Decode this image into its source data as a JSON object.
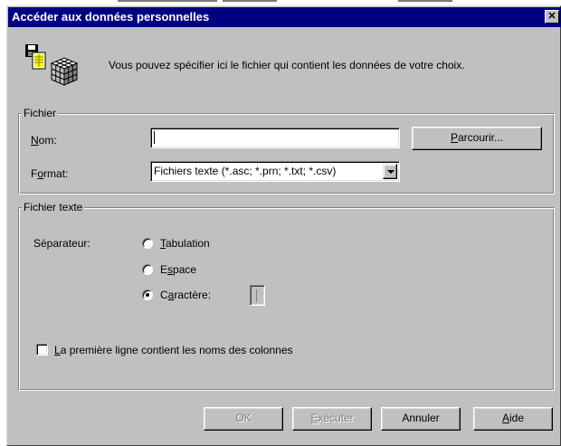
{
  "window": {
    "title": "Accéder aux données personnelles",
    "close_label": "✕"
  },
  "intro": {
    "text": "Vous pouvez spécifier ici le fichier qui contient les données de votre choix.",
    "icon": "database-files-icon"
  },
  "fichier_group": {
    "legend": "Fichier",
    "nom_label": {
      "pre": "",
      "key": "N",
      "post": "om:"
    },
    "nom_value": "",
    "browse_button": {
      "pre": "",
      "key": "P",
      "post": "arcourir..."
    },
    "format_label": {
      "pre": "F",
      "key": "o",
      "post": "rmat:"
    },
    "format_selected": "Fichiers texte (*.asc; *.prn; *.txt; *.csv)"
  },
  "texte_group": {
    "legend": "Fichier texte",
    "separator_label": "Séparateur:",
    "options": [
      {
        "pre": "",
        "key": "T",
        "post": "abulation",
        "selected": false
      },
      {
        "pre": "E",
        "key": "s",
        "post": "pace",
        "selected": false
      },
      {
        "pre": "C",
        "key": "a",
        "post": "ractère:",
        "selected": true
      }
    ],
    "character_value": "",
    "header_checkbox": {
      "pre": "",
      "key": "L",
      "post": "a première ligne contient les noms des colonnes",
      "checked": false
    }
  },
  "buttons": {
    "ok": "OK",
    "execute": {
      "pre": "",
      "key": "E",
      "post": "xécuter"
    },
    "cancel": "Annuler",
    "help": {
      "pre": "",
      "key": "A",
      "post": "ide"
    }
  },
  "colors": {
    "title_bg": "#000080",
    "dialog_bg": "#c0c0c0"
  }
}
